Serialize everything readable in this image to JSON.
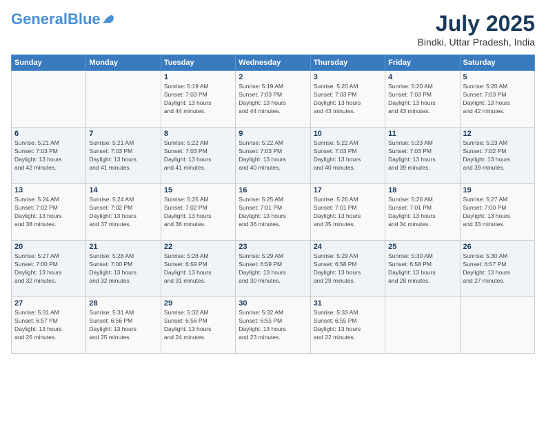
{
  "header": {
    "logo_line1": "General",
    "logo_line2": "Blue",
    "month_year": "July 2025",
    "location": "Bindki, Uttar Pradesh, India"
  },
  "weekdays": [
    "Sunday",
    "Monday",
    "Tuesday",
    "Wednesday",
    "Thursday",
    "Friday",
    "Saturday"
  ],
  "weeks": [
    [
      {
        "day": "",
        "info": ""
      },
      {
        "day": "",
        "info": ""
      },
      {
        "day": "1",
        "info": "Sunrise: 5:19 AM\nSunset: 7:03 PM\nDaylight: 13 hours\nand 44 minutes."
      },
      {
        "day": "2",
        "info": "Sunrise: 5:19 AM\nSunset: 7:03 PM\nDaylight: 13 hours\nand 44 minutes."
      },
      {
        "day": "3",
        "info": "Sunrise: 5:20 AM\nSunset: 7:03 PM\nDaylight: 13 hours\nand 43 minutes."
      },
      {
        "day": "4",
        "info": "Sunrise: 5:20 AM\nSunset: 7:03 PM\nDaylight: 13 hours\nand 43 minutes."
      },
      {
        "day": "5",
        "info": "Sunrise: 5:20 AM\nSunset: 7:03 PM\nDaylight: 13 hours\nand 42 minutes."
      }
    ],
    [
      {
        "day": "6",
        "info": "Sunrise: 5:21 AM\nSunset: 7:03 PM\nDaylight: 13 hours\nand 42 minutes."
      },
      {
        "day": "7",
        "info": "Sunrise: 5:21 AM\nSunset: 7:03 PM\nDaylight: 13 hours\nand 41 minutes."
      },
      {
        "day": "8",
        "info": "Sunrise: 5:22 AM\nSunset: 7:03 PM\nDaylight: 13 hours\nand 41 minutes."
      },
      {
        "day": "9",
        "info": "Sunrise: 5:22 AM\nSunset: 7:03 PM\nDaylight: 13 hours\nand 40 minutes."
      },
      {
        "day": "10",
        "info": "Sunrise: 5:22 AM\nSunset: 7:03 PM\nDaylight: 13 hours\nand 40 minutes."
      },
      {
        "day": "11",
        "info": "Sunrise: 5:23 AM\nSunset: 7:03 PM\nDaylight: 13 hours\nand 39 minutes."
      },
      {
        "day": "12",
        "info": "Sunrise: 5:23 AM\nSunset: 7:02 PM\nDaylight: 13 hours\nand 39 minutes."
      }
    ],
    [
      {
        "day": "13",
        "info": "Sunrise: 5:24 AM\nSunset: 7:02 PM\nDaylight: 13 hours\nand 38 minutes."
      },
      {
        "day": "14",
        "info": "Sunrise: 5:24 AM\nSunset: 7:02 PM\nDaylight: 13 hours\nand 37 minutes."
      },
      {
        "day": "15",
        "info": "Sunrise: 5:25 AM\nSunset: 7:02 PM\nDaylight: 13 hours\nand 36 minutes."
      },
      {
        "day": "16",
        "info": "Sunrise: 5:25 AM\nSunset: 7:01 PM\nDaylight: 13 hours\nand 36 minutes."
      },
      {
        "day": "17",
        "info": "Sunrise: 5:26 AM\nSunset: 7:01 PM\nDaylight: 13 hours\nand 35 minutes."
      },
      {
        "day": "18",
        "info": "Sunrise: 5:26 AM\nSunset: 7:01 PM\nDaylight: 13 hours\nand 34 minutes."
      },
      {
        "day": "19",
        "info": "Sunrise: 5:27 AM\nSunset: 7:00 PM\nDaylight: 13 hours\nand 33 minutes."
      }
    ],
    [
      {
        "day": "20",
        "info": "Sunrise: 5:27 AM\nSunset: 7:00 PM\nDaylight: 13 hours\nand 32 minutes."
      },
      {
        "day": "21",
        "info": "Sunrise: 5:28 AM\nSunset: 7:00 PM\nDaylight: 13 hours\nand 32 minutes."
      },
      {
        "day": "22",
        "info": "Sunrise: 5:28 AM\nSunset: 6:59 PM\nDaylight: 13 hours\nand 31 minutes."
      },
      {
        "day": "23",
        "info": "Sunrise: 5:29 AM\nSunset: 6:59 PM\nDaylight: 13 hours\nand 30 minutes."
      },
      {
        "day": "24",
        "info": "Sunrise: 5:29 AM\nSunset: 6:58 PM\nDaylight: 13 hours\nand 29 minutes."
      },
      {
        "day": "25",
        "info": "Sunrise: 5:30 AM\nSunset: 6:58 PM\nDaylight: 13 hours\nand 28 minutes."
      },
      {
        "day": "26",
        "info": "Sunrise: 5:30 AM\nSunset: 6:57 PM\nDaylight: 13 hours\nand 27 minutes."
      }
    ],
    [
      {
        "day": "27",
        "info": "Sunrise: 5:31 AM\nSunset: 6:57 PM\nDaylight: 13 hours\nand 26 minutes."
      },
      {
        "day": "28",
        "info": "Sunrise: 5:31 AM\nSunset: 6:56 PM\nDaylight: 13 hours\nand 25 minutes."
      },
      {
        "day": "29",
        "info": "Sunrise: 5:32 AM\nSunset: 6:56 PM\nDaylight: 13 hours\nand 24 minutes."
      },
      {
        "day": "30",
        "info": "Sunrise: 5:32 AM\nSunset: 6:55 PM\nDaylight: 13 hours\nand 23 minutes."
      },
      {
        "day": "31",
        "info": "Sunrise: 5:33 AM\nSunset: 6:55 PM\nDaylight: 13 hours\nand 22 minutes."
      },
      {
        "day": "",
        "info": ""
      },
      {
        "day": "",
        "info": ""
      }
    ]
  ]
}
